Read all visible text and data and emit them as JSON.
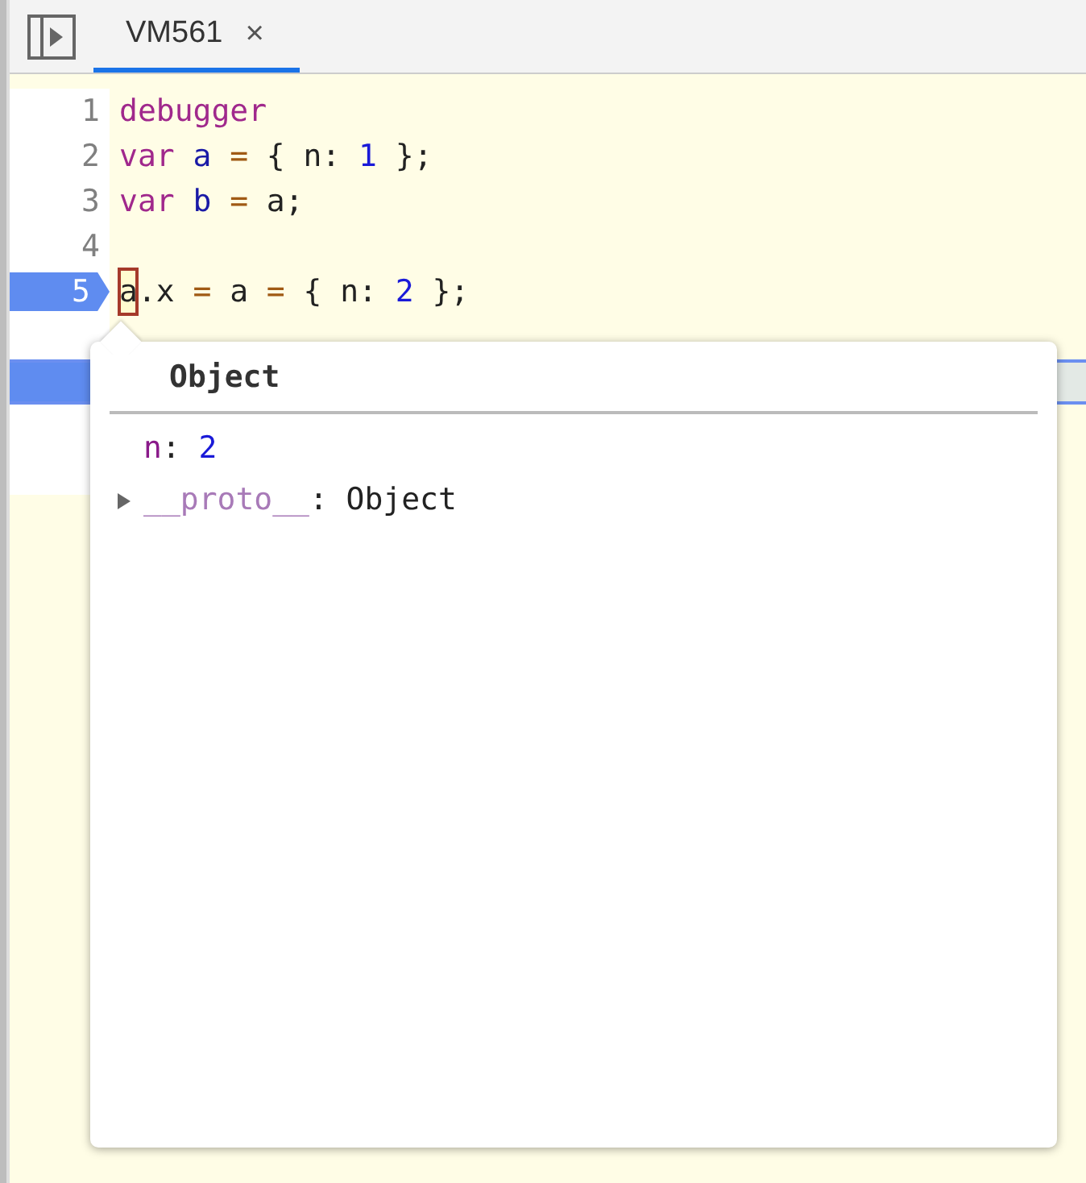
{
  "tabs": [
    {
      "label": "VM561",
      "selected": true,
      "close": "×"
    }
  ],
  "lines": [
    {
      "number": "1",
      "breakpoint": false,
      "current": false,
      "tokens": [
        {
          "kind": "keyword",
          "text": "debugger"
        }
      ]
    },
    {
      "number": "2",
      "breakpoint": false,
      "current": false,
      "tokens": [
        {
          "kind": "keyword",
          "text": "var"
        },
        {
          "kind": "def",
          "text": "a"
        },
        {
          "kind": "operator",
          "text": "="
        },
        {
          "kind": "plain",
          "text": "{"
        },
        {
          "kind": "plain",
          "text": "n:"
        },
        {
          "kind": "number",
          "text": "1"
        },
        {
          "kind": "plain",
          "text": "};"
        }
      ]
    },
    {
      "number": "3",
      "breakpoint": false,
      "current": false,
      "tokens": [
        {
          "kind": "keyword",
          "text": "var"
        },
        {
          "kind": "def",
          "text": "b"
        },
        {
          "kind": "operator",
          "text": "="
        },
        {
          "kind": "plain",
          "text": "a;"
        }
      ]
    },
    {
      "number": "4",
      "breakpoint": false,
      "current": false
    },
    {
      "number": "5",
      "breakpoint": true,
      "current": false,
      "tokens": [
        {
          "kind": "hovered",
          "text": "a"
        },
        {
          "kind": "joined",
          "text": ".x"
        },
        {
          "kind": "operator",
          "text": "="
        },
        {
          "kind": "plain",
          "text": "a"
        },
        {
          "kind": "operator",
          "text": "="
        },
        {
          "kind": "plain",
          "text": "{"
        },
        {
          "kind": "plain",
          "text": "n:"
        },
        {
          "kind": "number",
          "text": "2"
        },
        {
          "kind": "plain",
          "text": "};"
        }
      ]
    },
    {
      "breakpoint": false,
      "current": false
    },
    {
      "breakpoint": true,
      "current": true
    },
    {
      "breakpoint": false,
      "current": false
    },
    {
      "breakpoint": false,
      "current": false
    }
  ],
  "popover": {
    "title": "Object",
    "properties": [
      {
        "kind": "value",
        "name": "n",
        "colon": ":",
        "value": "2"
      },
      {
        "kind": "expandable",
        "name": "__proto__",
        "colon": ":",
        "value": "Object",
        "expanded": false
      }
    ]
  }
}
